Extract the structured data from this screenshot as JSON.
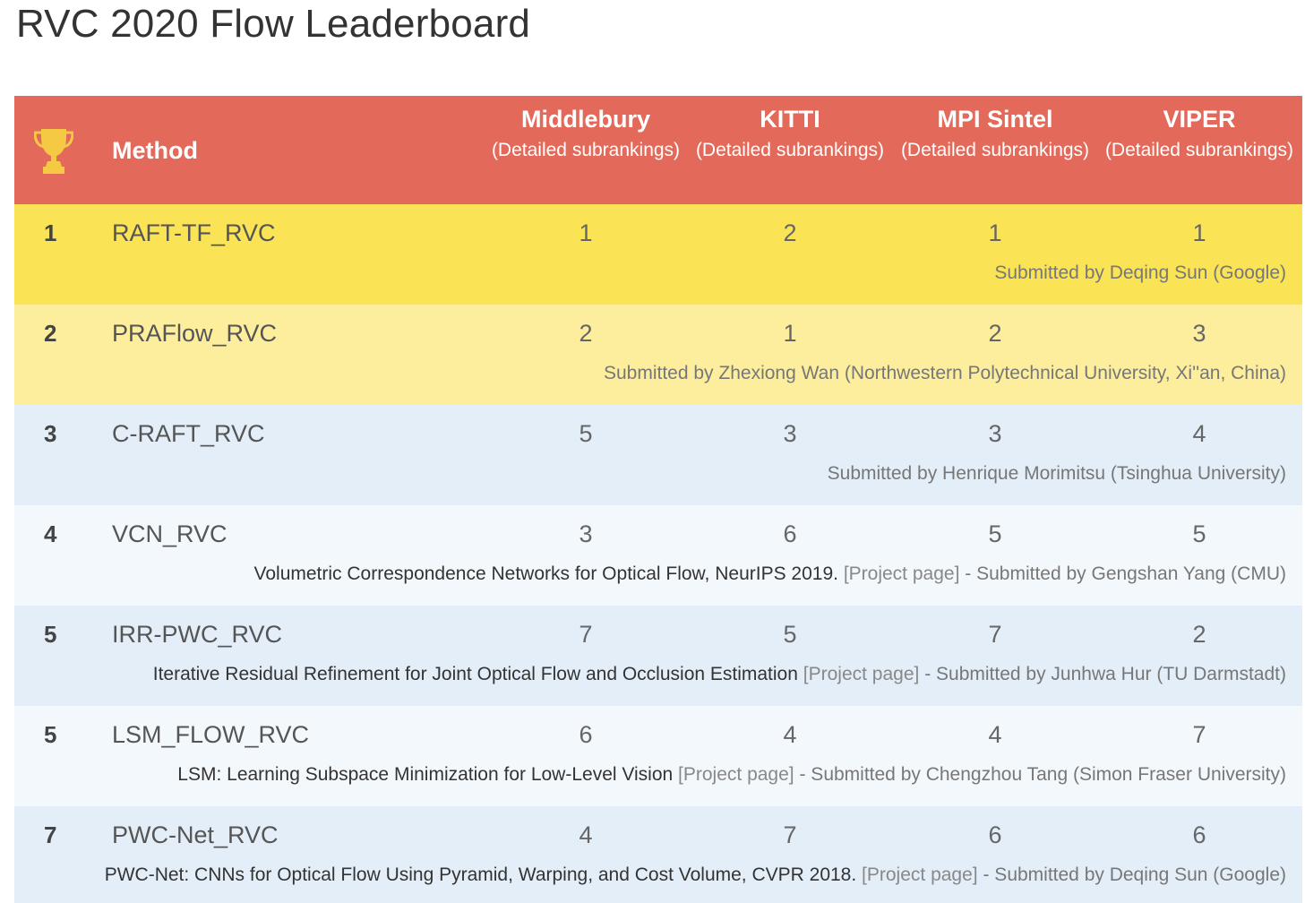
{
  "page_title": "RVC 2020 Flow Leaderboard",
  "header": {
    "method_label": "Method",
    "columns": [
      {
        "name": "Middlebury",
        "sub": "(Detailed subrankings)"
      },
      {
        "name": "KITTI",
        "sub": "(Detailed subrankings)"
      },
      {
        "name": "MPI Sintel",
        "sub": "(Detailed subrankings)"
      },
      {
        "name": "VIPER",
        "sub": "(Detailed subrankings)"
      }
    ]
  },
  "colors": {
    "header_bg": "#e36a5a",
    "trophy": "#f6c945",
    "row_first": "#fae354",
    "row_second": "#fcee9c",
    "row_blue": "#e3eef9",
    "row_light": "#f3f8fd"
  },
  "rows": [
    {
      "rank": "1",
      "method": "RAFT-TF_RVC",
      "scores": [
        "1",
        "2",
        "1",
        "1"
      ],
      "paper": "",
      "project": "",
      "submitted": "Submitted by Deqing Sun (Google)"
    },
    {
      "rank": "2",
      "method": "PRAFlow_RVC",
      "scores": [
        "2",
        "1",
        "2",
        "3"
      ],
      "paper": "",
      "project": "",
      "submitted": "Submitted by Zhexiong Wan (Northwestern Polytechnical University, Xi''an, China)"
    },
    {
      "rank": "3",
      "method": "C-RAFT_RVC",
      "scores": [
        "5",
        "3",
        "3",
        "4"
      ],
      "paper": "",
      "project": "",
      "submitted": "Submitted by Henrique Morimitsu (Tsinghua University)"
    },
    {
      "rank": "4",
      "method": "VCN_RVC",
      "scores": [
        "3",
        "6",
        "5",
        "5"
      ],
      "paper": "Volumetric Correspondence Networks for Optical Flow, NeurIPS 2019.",
      "project": "[Project page]",
      "submitted": "- Submitted by Gengshan Yang (CMU)"
    },
    {
      "rank": "5",
      "method": "IRR-PWC_RVC",
      "scores": [
        "7",
        "5",
        "7",
        "2"
      ],
      "paper": "Iterative Residual Refinement for Joint Optical Flow and Occlusion Estimation",
      "project": "[Project page]",
      "submitted": "- Submitted by Junhwa Hur (TU Darmstadt)"
    },
    {
      "rank": "5",
      "method": "LSM_FLOW_RVC",
      "scores": [
        "6",
        "4",
        "4",
        "7"
      ],
      "paper": "LSM: Learning Subspace Minimization for Low-Level Vision",
      "project": "[Project page]",
      "submitted": "- Submitted by Chengzhou Tang (Simon Fraser University)"
    },
    {
      "rank": "7",
      "method": "PWC-Net_RVC",
      "scores": [
        "4",
        "7",
        "6",
        "6"
      ],
      "paper": "PWC-Net: CNNs for Optical Flow Using Pyramid, Warping, and Cost Volume, CVPR 2018.",
      "project": "[Project page]",
      "submitted": "- Submitted by Deqing Sun (Google)"
    }
  ]
}
